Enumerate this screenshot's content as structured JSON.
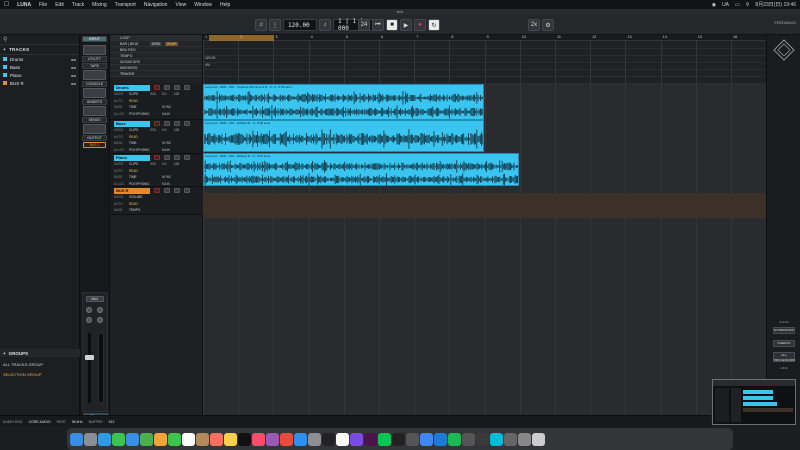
{
  "menubar": {
    "app": "LUNA",
    "items": [
      "File",
      "Edit",
      "Track",
      "Mixing",
      "Transport",
      "Navigation",
      "View",
      "Window",
      "Help"
    ],
    "status": "UA",
    "clock": "8月23日(日) 19:46"
  },
  "window": {
    "title": "test"
  },
  "transport": {
    "tempo": "120.00",
    "position": "1 | 1 | 000",
    "feedback_label": "FEEDBACK",
    "mode_a": "24",
    "mode_b": "2x"
  },
  "nav": {
    "tracks_header": "TRACKS",
    "tracks": [
      {
        "name": "Drums",
        "color": "#39c5f0"
      },
      {
        "name": "Bass",
        "color": "#39c5f0"
      },
      {
        "name": "Piano",
        "color": "#39c5f0"
      },
      {
        "name": "BUS R",
        "color": "#e58a2a"
      }
    ],
    "groups_header": "GROUPS",
    "groups": [
      "ALL TRACKS GROUP",
      "SELECTION GROUP"
    ]
  },
  "inspector": {
    "sections": [
      "INPUT",
      "UTILITY",
      "TAPE",
      "CONSOLE",
      "INSERTS",
      "SENDS",
      "OUTPUT"
    ],
    "output_value": "BUS 1",
    "strip_input": "Mic/L",
    "strip_label": "Piano"
  },
  "ruler_rows": [
    {
      "label": "LOOP",
      "value": ""
    },
    {
      "label": "BAR | BEAT",
      "value": ""
    },
    {
      "label": "BBU REG",
      "value": ""
    },
    {
      "label": "TEMPO",
      "value": "120.00"
    },
    {
      "label": "SIGNATURE",
      "value": "4/4"
    },
    {
      "label": "MARKERS",
      "value": ""
    }
  ],
  "ruler_controls": {
    "a": "DRM",
    "b": "SNAP"
  },
  "tracks_header": "TRACKS",
  "bars": [
    "1",
    "2",
    "3",
    "4",
    "5",
    "6",
    "7",
    "8",
    "9",
    "10",
    "11",
    "12",
    "13",
    "14",
    "15",
    "16",
    "17",
    "18",
    "19"
  ],
  "tracks": [
    {
      "name": "Drums",
      "color": "#39c5f0",
      "rows": [
        {
          "k": "MODE",
          "v": "CLIPS",
          "a": "VOL",
          "b": "0.0",
          "c": "100"
        },
        {
          "k": "AUTO",
          "v": "READ",
          "a": "",
          "b": "",
          "c": ""
        },
        {
          "k": "BASE",
          "v": "TIME",
          "a": "",
          "b": "NONE",
          "c": ""
        },
        {
          "k": "ALLOC",
          "v": "POLYPHONIC",
          "a": "",
          "b": "MAIN",
          "c": ""
        }
      ]
    },
    {
      "name": "Bass",
      "color": "#39c5f0",
      "rows": [
        {
          "k": "MODE",
          "v": "CLIPS",
          "a": "VOL",
          "b": "0.0",
          "c": "100"
        },
        {
          "k": "AUTO",
          "v": "READ",
          "a": "",
          "b": "",
          "c": ""
        },
        {
          "k": "BASE",
          "v": "TIME",
          "a": "",
          "b": "NONE",
          "c": ""
        },
        {
          "k": "ALLOC",
          "v": "POLYPHONIC",
          "a": "",
          "b": "MAIN",
          "c": ""
        }
      ]
    },
    {
      "name": "Piano",
      "color": "#39c5f0",
      "rows": [
        {
          "k": "MODE",
          "v": "CLIPS",
          "a": "VOL",
          "b": "0.0",
          "c": "100"
        },
        {
          "k": "AUTO",
          "v": "READ",
          "a": "",
          "b": "",
          "c": ""
        },
        {
          "k": "BASE",
          "v": "TIME",
          "a": "",
          "b": "NONE",
          "c": ""
        },
        {
          "k": "ALLOC",
          "v": "POLYPHONIC",
          "a": "",
          "b": "MAIN",
          "c": ""
        }
      ]
    },
    {
      "name": "BUS R",
      "color": "#e58a2a",
      "rows": [
        {
          "k": "MODE",
          "v": "VOLUME",
          "a": "",
          "b": "",
          "c": ""
        },
        {
          "k": "AUTO",
          "v": "READ",
          "a": "",
          "b": "",
          "c": ""
        },
        {
          "k": "BASE",
          "v": "TEMPO",
          "a": "",
          "b": "",
          "c": ""
        }
      ]
    }
  ],
  "clips": [
    {
      "track": 0,
      "title": "Loop test - 0001 - 801 - Superior Drummer 3 R - 0 - 0 - 0.00 semi"
    },
    {
      "track": 1,
      "title": "Loop test - 0001 - 801 - EZbass R - 0 - 0.00 semi"
    },
    {
      "track": 2,
      "title": "Loop test - 0001 - 801 - EZkeys R - 0 - 0.00 semi"
    }
  ],
  "right_panel": {
    "title": "FEEDBACK",
    "buttons": [
      "EXTENSIONS",
      "INSERTS",
      "ALL PROCESSORS"
    ],
    "labels": [
      "SHOW",
      "HIDE"
    ]
  },
  "status": {
    "audio_label": "AUDIO ENG",
    "audio_value": "CORE AUDIO",
    "rate_label": "RATE",
    "rate_value": "96 kHz",
    "buffer_label": "BUFFER",
    "buffer_value": "512"
  },
  "dock_icons": [
    "finder",
    "launchpad",
    "safari",
    "messages",
    "mail",
    "maps",
    "photos",
    "facetime",
    "calendar",
    "contacts",
    "reminders",
    "notes",
    "tv",
    "music",
    "podcasts",
    "news",
    "appstore",
    "settings",
    "luna",
    "notion",
    "pt",
    "slack",
    "line",
    "ua",
    "console",
    "chrome",
    "xcode",
    "spotify",
    "more1",
    "more2",
    "more3",
    "more4",
    "more5",
    "trash"
  ]
}
